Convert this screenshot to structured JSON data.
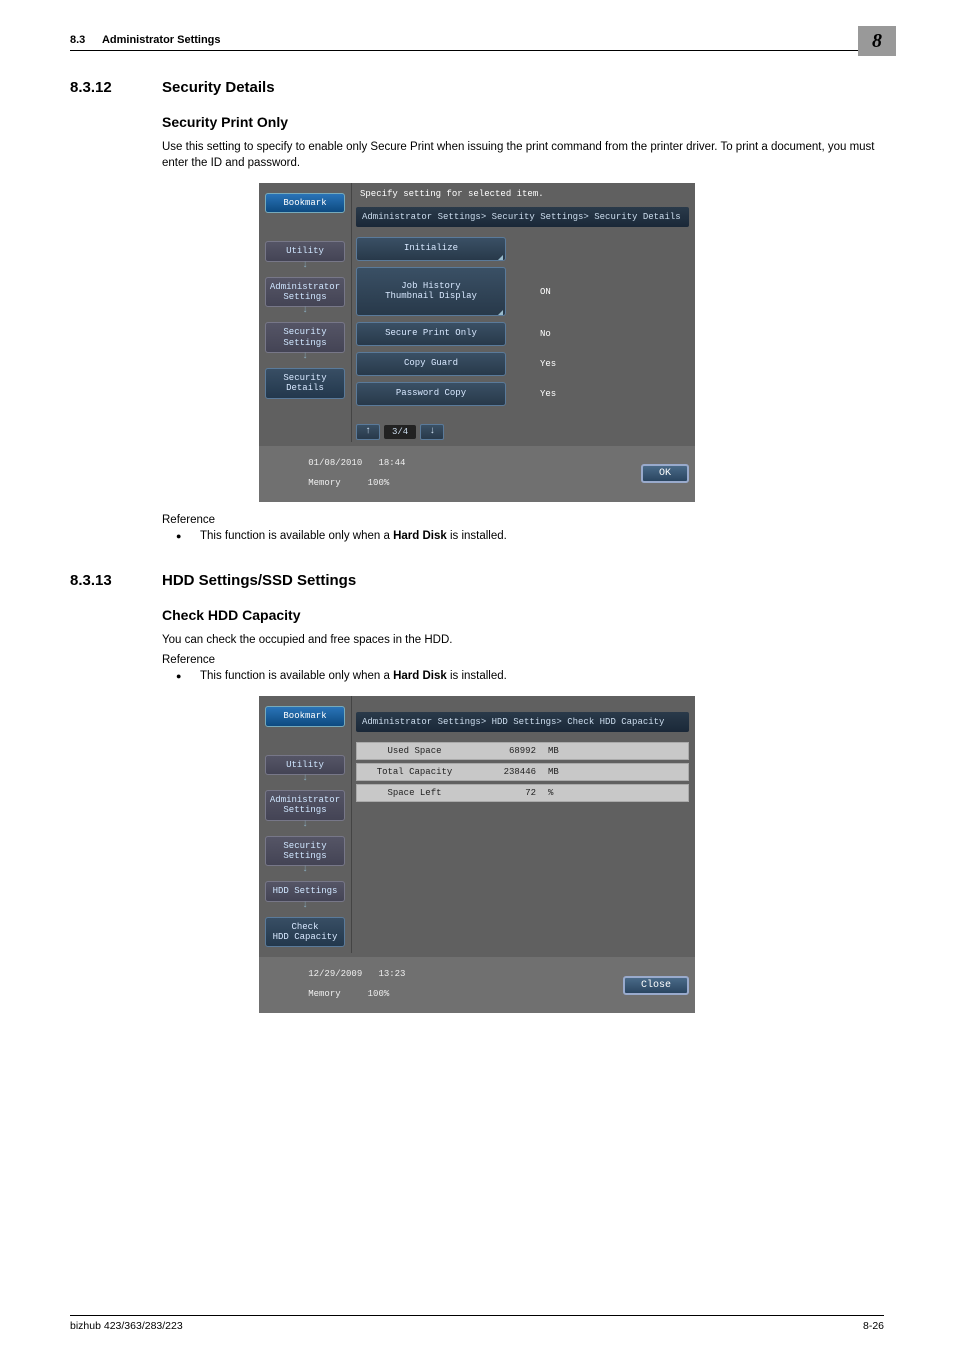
{
  "header": {
    "section_no": "8.3",
    "section_title": "Administrator Settings",
    "chapter_no": "8"
  },
  "s1": {
    "num": "8.3.12",
    "title": "Security Details",
    "sub": "Security Print Only",
    "p1": "Use this setting to specify to enable only Secure Print when issuing the print command from the printer driver. To print a document, you must enter the ID and password.",
    "ref_label": "Reference",
    "ref1_pre": "This function is available only when a ",
    "ref1_bold": "Hard Disk",
    "ref1_post": " is installed."
  },
  "s2": {
    "num": "8.3.13",
    "title": "HDD Settings/SSD Settings",
    "sub": "Check HDD Capacity",
    "p1": "You can check the occupied and free spaces in the HDD.",
    "ref_label": "Reference",
    "ref1_pre": "This function is available only when a ",
    "ref1_bold": "Hard Disk",
    "ref1_post": " is installed."
  },
  "panel1": {
    "instruction": "Specify setting for selected item.",
    "crumb": "Administrator Settings> Security Settings> Security Details",
    "bookmark": "Bookmark",
    "side": {
      "utility": "Utility",
      "admin": "Administrator\nSettings",
      "sec": "Security\nSettings",
      "secdet": "Security Details"
    },
    "rows": {
      "init": "Initialize",
      "jobhist": "Job History\nThumbnail Display",
      "jobhist_v": "ON",
      "spo": "Secure Print Only",
      "spo_v": "No",
      "cg": "Copy Guard",
      "cg_v": "Yes",
      "pc": "Password Copy",
      "pc_v": "Yes"
    },
    "pager": "3/4",
    "foot": {
      "date": "01/08/2010",
      "time": "18:44",
      "mem_l": "Memory",
      "mem_v": "100%",
      "ok": "OK"
    }
  },
  "panel2": {
    "crumb": "Administrator Settings> HDD Settings> Check HDD Capacity",
    "bookmark": "Bookmark",
    "side": {
      "utility": "Utility",
      "admin": "Administrator\nSettings",
      "sec": "Security\nSettings",
      "hdd": "HDD Settings",
      "chk": "Check\nHDD Capacity"
    },
    "rows": {
      "used_l": "Used Space",
      "used_v": "68992",
      "used_u": "MB",
      "total_l": "Total Capacity",
      "total_v": "238446",
      "total_u": "MB",
      "left_l": "Space Left",
      "left_v": "72",
      "left_u": "%"
    },
    "foot": {
      "date": "12/29/2009",
      "time": "13:23",
      "mem_l": "Memory",
      "mem_v": "100%",
      "close": "Close"
    }
  },
  "footer": {
    "model": "bizhub 423/363/283/223",
    "page": "8-26"
  }
}
